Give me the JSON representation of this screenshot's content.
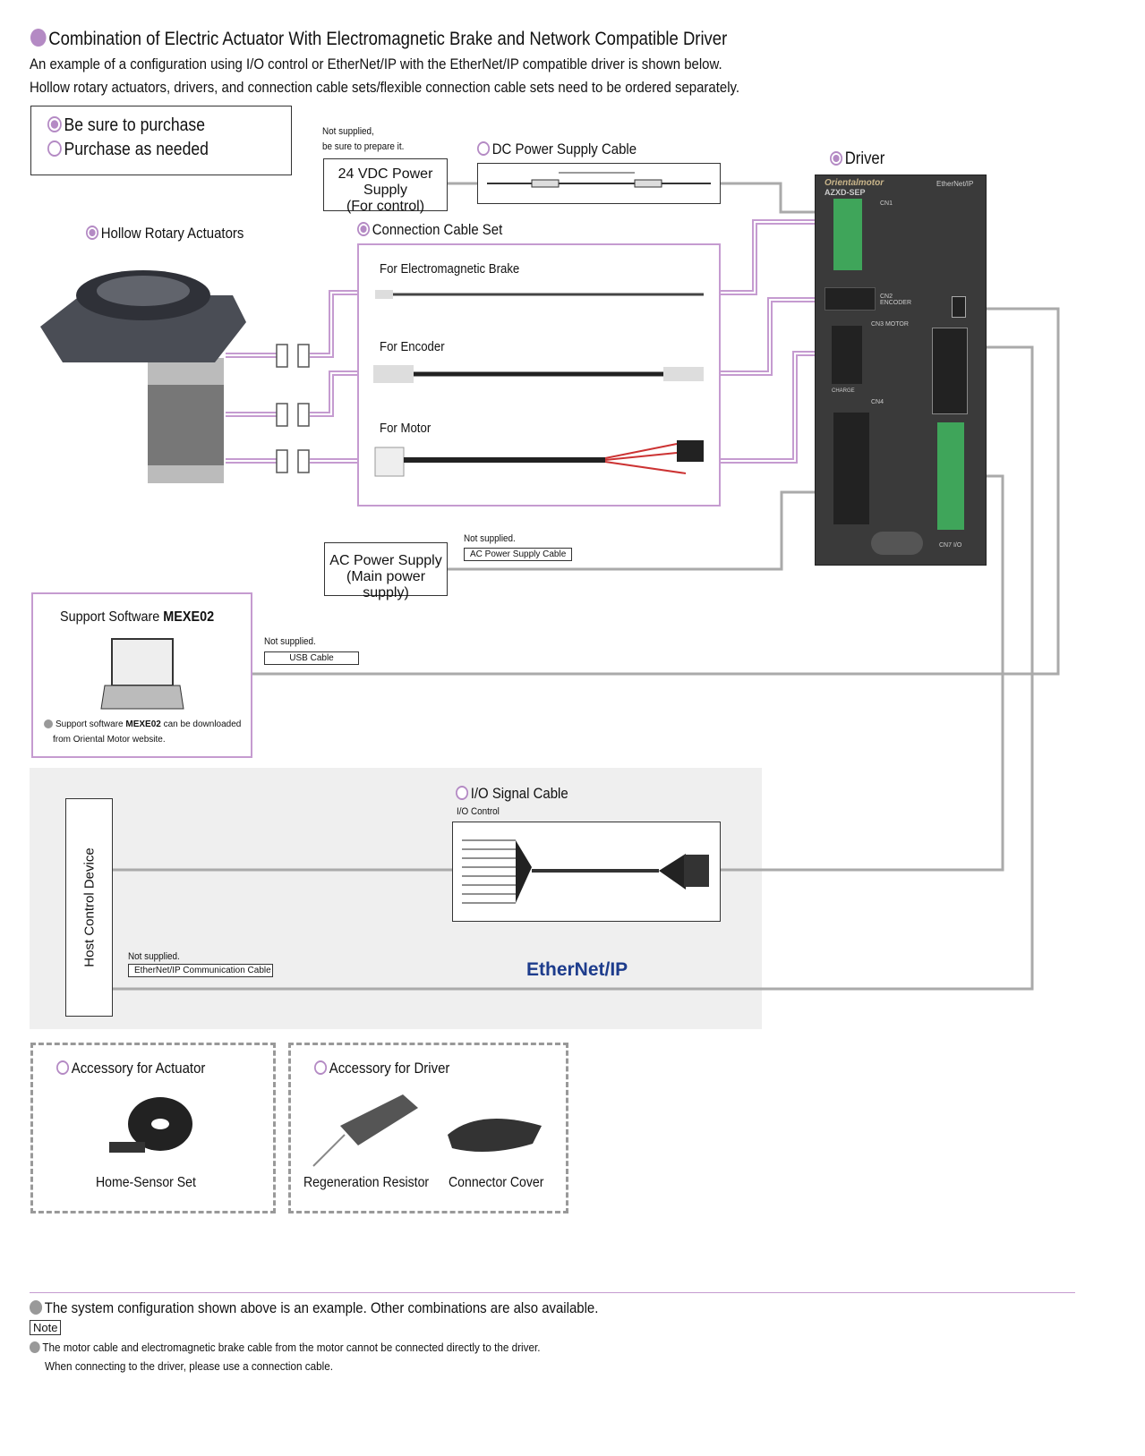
{
  "title": "Combination of Electric Actuator With Electromagnetic Brake and Network Compatible Driver",
  "subtitle1": "An example of a configuration using I/O control or EtherNet/IP with the EtherNet/IP compatible driver is shown below.",
  "subtitle2": "Hollow rotary actuators, drivers, and connection cable sets/flexible connection cable sets need to be ordered separately.",
  "legend": {
    "purchase": "Be sure to purchase",
    "as_needed": "Purchase as needed"
  },
  "not_supplied_prepare": [
    "Not supplied,",
    "be sure to prepare it."
  ],
  "dc_supply": [
    "24 VDC Power Supply",
    "(For control)"
  ],
  "dc_cable": "DC Power Supply Cable",
  "driver": {
    "label": "Driver",
    "brand": "Orientalmotor",
    "model": "AZXD-SEP",
    "network": "EtherNet/IP",
    "cn1": "CN1",
    "cn2": "CN2 ENCODER",
    "cn3": "CN3 MOTOR",
    "cn4": "CN4",
    "cn7": "CN7 I/O",
    "charge": "CHARGE"
  },
  "actuator_label": "Hollow Rotary Actuators",
  "cable_set": {
    "label": "Connection Cable Set",
    "brake": "For Electromagnetic Brake",
    "encoder": "For Encoder",
    "motor": "For Motor"
  },
  "ac_supply": [
    "AC Power Supply",
    "(Main power supply)"
  ],
  "ac_cable": {
    "note": "Not supplied.",
    "label": "AC Power Supply Cable"
  },
  "software": {
    "title": "Support Software ",
    "name": "MEXE02",
    "note1": "Support software ",
    "note_name": "MEXE02",
    "note2": " can be downloaded",
    "note3": "from Oriental Motor website."
  },
  "usb": {
    "note": "Not supplied.",
    "label": "USB Cable"
  },
  "host": "Host Control Device",
  "io_cable": {
    "label": "I/O Signal Cable",
    "sub": "I/O Control"
  },
  "eip_cable": {
    "note": "Not supplied.",
    "label": "EtherNet/IP Communication Cable"
  },
  "eip_logo": "EtherNet/IP",
  "acc_actuator": {
    "label": "Accessory for Actuator",
    "item": "Home-Sensor Set"
  },
  "acc_driver": {
    "label": "Accessory for Driver",
    "item1": "Regeneration Resistor",
    "item2": "Connector Cover"
  },
  "footer": {
    "note1": "The system configuration shown above is an example. Other combinations are also available.",
    "note_tag": "Note",
    "note2": "The motor cable and electromagnetic brake cable from the motor cannot be connected directly to the driver.",
    "note3": "When connecting to the driver, please use a connection cable."
  },
  "colors": {
    "accent": "#b48ac4",
    "line_gray": "#aaaaaa",
    "driver_body": "#3a3a3a",
    "band": "#efefef"
  }
}
